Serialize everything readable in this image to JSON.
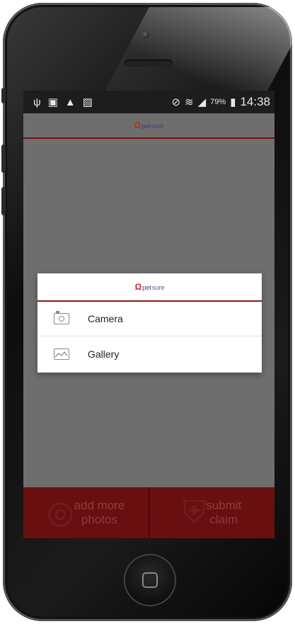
{
  "statusbar": {
    "left_icons": [
      "usb-icon",
      "image-icon",
      "warning-icon",
      "no-sim-icon"
    ],
    "right_icons": [
      "mute-icon",
      "wifi-icon",
      "signal-icon"
    ],
    "battery_percent": "79%",
    "time": "14:38"
  },
  "appbar": {
    "logo_mark": "Ω",
    "logo_pet": "pet",
    "logo_sure": "sure"
  },
  "dialog": {
    "logo_mark": "Ω",
    "logo_pet": "pet",
    "logo_sure": "sure",
    "items": [
      {
        "label": "Camera",
        "icon": "camera-icon"
      },
      {
        "label": "Gallery",
        "icon": "gallery-icon"
      }
    ]
  },
  "bottombar": {
    "add_label": "add more\nphotos",
    "submit_label": "submit\nclaim"
  },
  "colors": {
    "accent": "#7a1010",
    "bottom_bar": "#6a0f0f",
    "overlay": "#6e6e6e",
    "statusbar": "#1d1d1d"
  }
}
